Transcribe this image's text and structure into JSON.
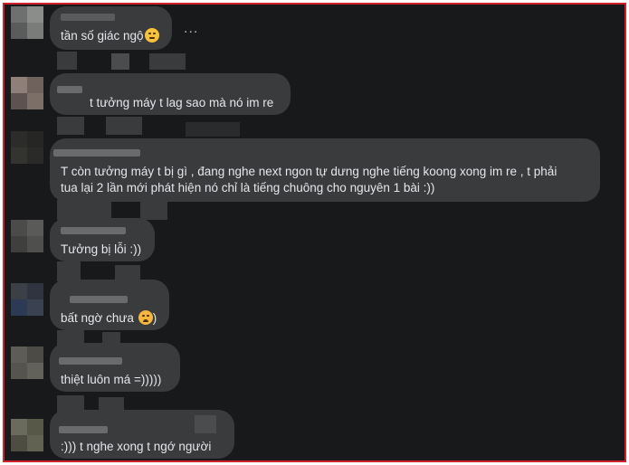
{
  "comments": [
    {
      "text": "tần số giác ngộ",
      "emoji": "smirk-face-emoji"
    },
    {
      "text": "t tưởng máy t lag sao mà nó im re"
    },
    {
      "line1": "T còn tưởng máy t bị gì , đang nghe next ngon tự dưng nghe tiếng koong xong im re , t phải",
      "line2": "tua lại 2 lần mới phát hiện nó chỉ là tiếng chuông cho nguyên 1 bài :))"
    },
    {
      "text": "Tưởng bị lỗi :))"
    },
    {
      "text": "bất ngờ chưa ",
      "emoji": "frowning-face-emoji",
      "suffix": ")"
    },
    {
      "text": "thiệt luôn má =)))))"
    },
    {
      "text": ":))) t nghe xong t ngớ người"
    }
  ],
  "more_label": "...",
  "colors": {
    "background": "#18191a",
    "bubble": "#3a3b3c",
    "text": "#e4e6eb",
    "border": "#d3202a"
  }
}
